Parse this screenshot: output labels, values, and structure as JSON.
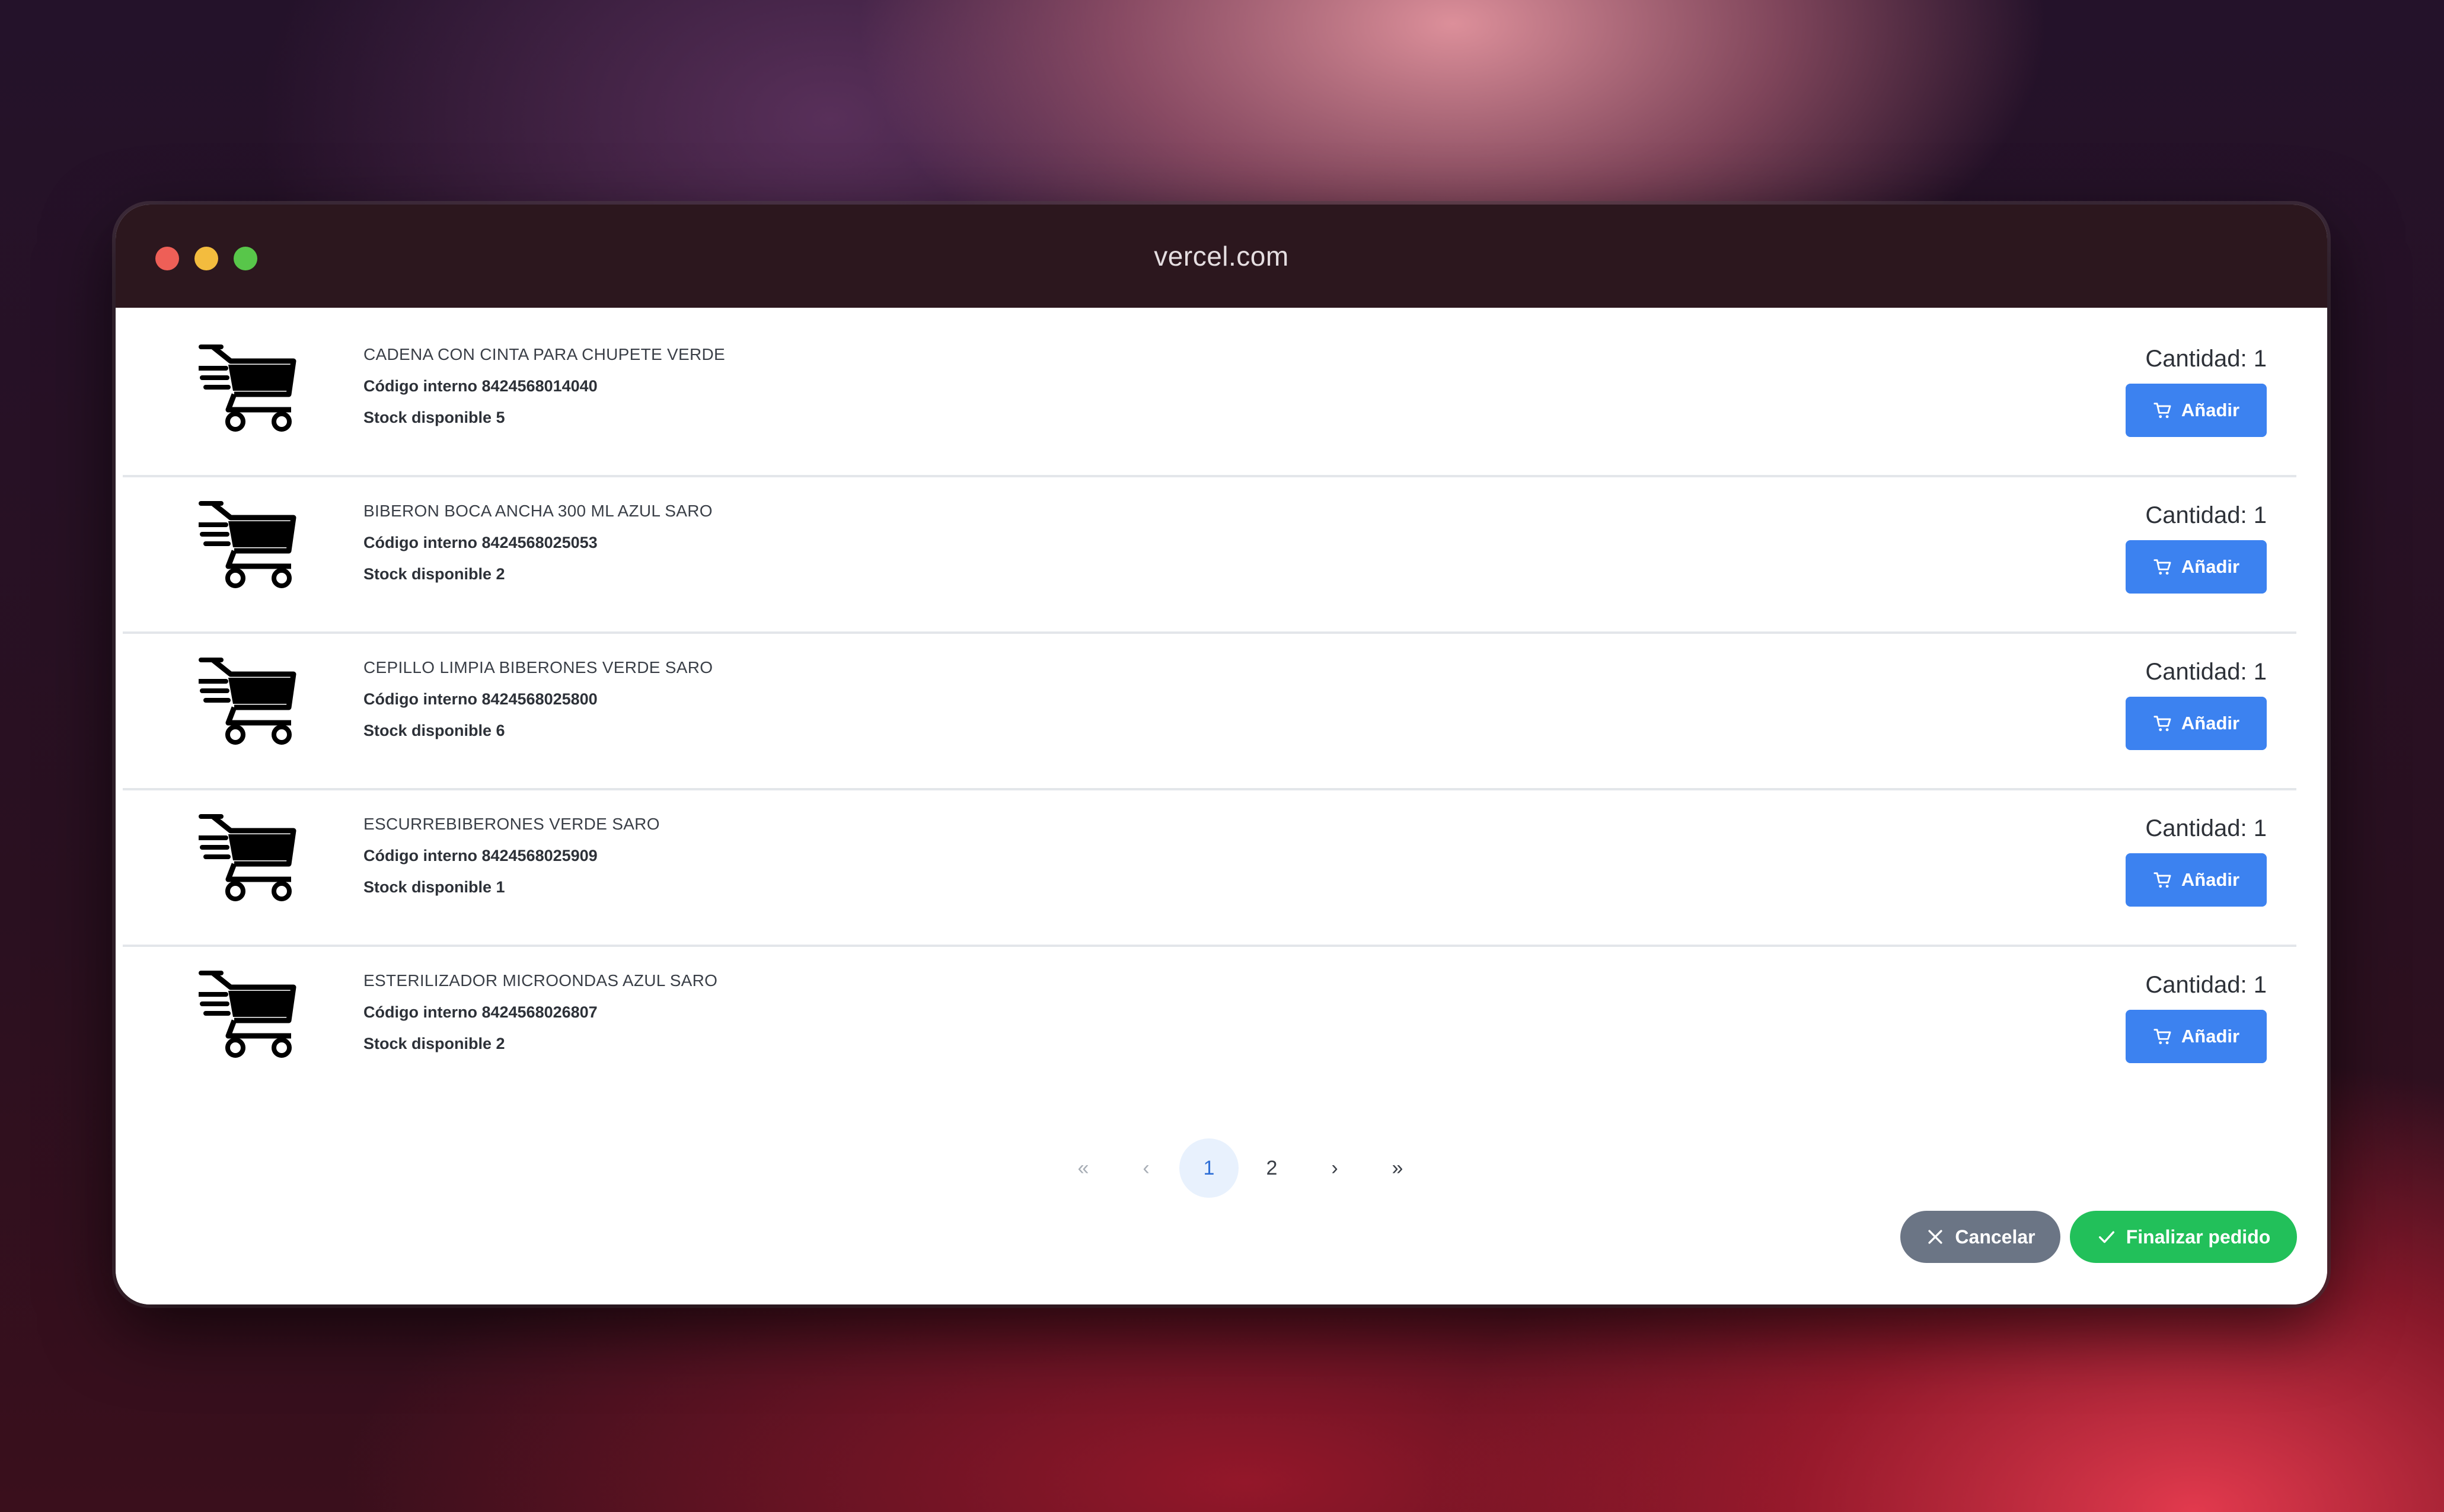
{
  "window": {
    "url": "vercel.com"
  },
  "products": [
    {
      "name": "CADENA CON CINTA PARA CHUPETE VERDE",
      "code_line": "Código interno 8424568014040",
      "stock_line": "Stock disponible 5",
      "qty_label": "Cantidad: 1",
      "add_label": "Añadir",
      "icon": "cart-speed-icon"
    },
    {
      "name": "BIBERON BOCA ANCHA 300 ML AZUL SARO",
      "code_line": "Código interno 8424568025053",
      "stock_line": "Stock disponible 2",
      "qty_label": "Cantidad: 1",
      "add_label": "Añadir",
      "icon": "cart-speed-icon"
    },
    {
      "name": "CEPILLO LIMPIA BIBERONES VERDE SARO",
      "code_line": "Código interno 8424568025800",
      "stock_line": "Stock disponible 6",
      "qty_label": "Cantidad: 1",
      "add_label": "Añadir",
      "icon": "cart-speed-icon"
    },
    {
      "name": "ESCURREBIBERONES VERDE SARO",
      "code_line": "Código interno 8424568025909",
      "stock_line": "Stock disponible 1",
      "qty_label": "Cantidad: 1",
      "add_label": "Añadir",
      "icon": "cart-speed-icon"
    },
    {
      "name": "ESTERILIZADOR MICROONDAS AZUL SARO",
      "code_line": "Código interno 8424568026807",
      "stock_line": "Stock disponible 2",
      "qty_label": "Cantidad: 1",
      "add_label": "Añadir",
      "icon": "cart-speed-icon"
    }
  ],
  "pagination": {
    "first": "«",
    "prev": "‹",
    "pages": [
      "1",
      "2"
    ],
    "current": "1",
    "next": "›",
    "last": "»"
  },
  "actions": {
    "cancel_label": "Cancelar",
    "finish_label": "Finalizar pedido"
  },
  "colors": {
    "primary": "#3c82f0",
    "success": "#22c05a",
    "secondary": "#6b7585",
    "titlebar": "#2c171e"
  }
}
